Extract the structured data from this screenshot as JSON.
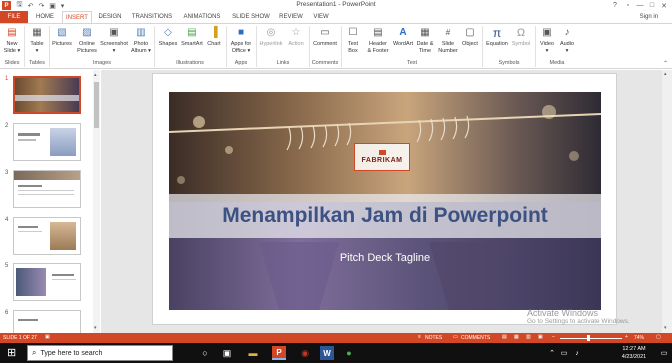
{
  "window": {
    "title": "Presentation1 - PowerPoint",
    "controls": [
      "?",
      "▫",
      "—",
      "□",
      "✕"
    ]
  },
  "quick_access": [
    "save-icon",
    "undo-icon",
    "redo-icon",
    "start-icon",
    "customize-icon"
  ],
  "tabs": [
    {
      "label": "FILE",
      "active": false
    },
    {
      "label": "HOME",
      "active": false
    },
    {
      "label": "INSERT",
      "active": true
    },
    {
      "label": "DESIGN",
      "active": false
    },
    {
      "label": "TRANSITIONS",
      "active": false
    },
    {
      "label": "ANIMATIONS",
      "active": false
    },
    {
      "label": "SLIDE SHOW",
      "active": false
    },
    {
      "label": "REVIEW",
      "active": false
    },
    {
      "label": "VIEW",
      "active": false
    }
  ],
  "signin": "Sign in",
  "ribbon": {
    "buttons": [
      {
        "icon": "new-slide-icon",
        "label": "New",
        "label2": "Slide ▾"
      },
      {
        "icon": "table-icon",
        "label": "Table",
        "label2": "▾"
      },
      {
        "icon": "pictures-icon",
        "label": "Pictures",
        "label2": ""
      },
      {
        "icon": "online-pictures-icon",
        "label": "Online",
        "label2": "Pictures"
      },
      {
        "icon": "screenshot-icon",
        "label": "Screenshot",
        "label2": "▾"
      },
      {
        "icon": "photo-album-icon",
        "label": "Photo",
        "label2": "Album ▾"
      },
      {
        "icon": "shapes-icon",
        "label": "Shapes",
        "label2": ""
      },
      {
        "icon": "smartart-icon",
        "label": "SmartArt",
        "label2": ""
      },
      {
        "icon": "chart-icon",
        "label": "Chart",
        "label2": ""
      },
      {
        "icon": "apps-for-office-icon",
        "label": "Apps for",
        "label2": "Office ▾"
      },
      {
        "icon": "hyperlink-icon",
        "label": "Hyperlink",
        "label2": ""
      },
      {
        "icon": "action-icon",
        "label": "Action",
        "label2": ""
      },
      {
        "icon": "comment-icon",
        "label": "Comment",
        "label2": ""
      },
      {
        "icon": "text-box-icon",
        "label": "Text",
        "label2": "Box"
      },
      {
        "icon": "header-footer-icon",
        "label": "Header",
        "label2": "& Footer"
      },
      {
        "icon": "wordart-icon",
        "label": "WordArt",
        "label2": ""
      },
      {
        "icon": "date-time-icon",
        "label": "Date &",
        "label2": "Time"
      },
      {
        "icon": "slide-number-icon",
        "label": "Slide",
        "label2": "Number"
      },
      {
        "icon": "object-icon",
        "label": "Object",
        "label2": ""
      },
      {
        "icon": "equation-icon",
        "label": "Equation",
        "label2": ""
      },
      {
        "icon": "symbol-icon",
        "label": "Symbol",
        "label2": ""
      },
      {
        "icon": "video-icon",
        "label": "Video",
        "label2": "▾"
      },
      {
        "icon": "audio-icon",
        "label": "Audio",
        "label2": "▾"
      }
    ],
    "groups": [
      "Slides",
      "Tables",
      "Images",
      "Illustrations",
      "Apps",
      "Links",
      "Comments",
      "Text",
      "Symbols",
      "Media"
    ]
  },
  "thumbnails": [
    {
      "num": "1",
      "selected": true
    },
    {
      "num": "2",
      "selected": false
    },
    {
      "num": "3",
      "selected": false
    },
    {
      "num": "4",
      "selected": false
    },
    {
      "num": "5",
      "selected": false
    },
    {
      "num": "6",
      "selected": false
    }
  ],
  "slide": {
    "logo": "FABRIKAM",
    "title": "Menampilkan Jam di Powerpoint",
    "subtitle": "Pitch Deck Tagline"
  },
  "watermark": {
    "line1": "Activate Windows",
    "line2": "Go to Settings to activate Windows."
  },
  "status": {
    "slide_info": "SLIDE 1 OF 27",
    "notes": "NOTES",
    "comments": "COMMENTS",
    "zoom": "74%",
    "zoom_fraction": 0.45
  },
  "taskbar": {
    "search_placeholder": "Type here to search",
    "time": "12:27 AM",
    "date": "4/23/2021"
  },
  "colors": {
    "accent": "#d24726",
    "title_text": "#3c5282"
  }
}
